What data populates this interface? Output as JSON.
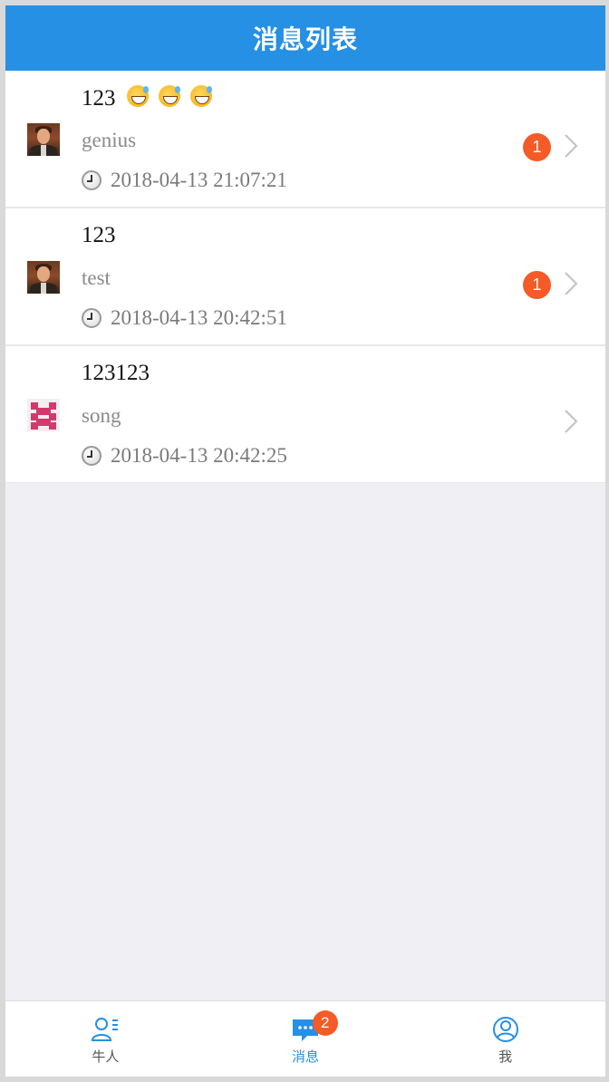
{
  "header": {
    "title": "消息列表"
  },
  "messages": [
    {
      "text": "123",
      "emoji_count": 3,
      "emoji": "sweat-smile-emoji",
      "sender": "genius",
      "time": "2018-04-13 21:07:21",
      "unread": "1",
      "avatar": "photo-avatar"
    },
    {
      "text": "123",
      "sender": "test",
      "time": "2018-04-13 20:42:51",
      "unread": "1",
      "avatar": "photo-avatar"
    },
    {
      "text": "123123",
      "sender": "song",
      "time": "2018-04-13 20:42:25",
      "unread": "",
      "avatar": "identicon-avatar"
    }
  ],
  "tabbar": {
    "tabs": [
      {
        "label": "牛人",
        "icon": "user-list-icon",
        "active": false
      },
      {
        "label": "消息",
        "icon": "chat-bubble-icon",
        "active": true,
        "badge": "2"
      },
      {
        "label": "我",
        "icon": "user-circle-icon",
        "active": false
      }
    ]
  },
  "colors": {
    "primary": "#2590e4",
    "badge": "#f45b27",
    "background": "#efeff4"
  }
}
